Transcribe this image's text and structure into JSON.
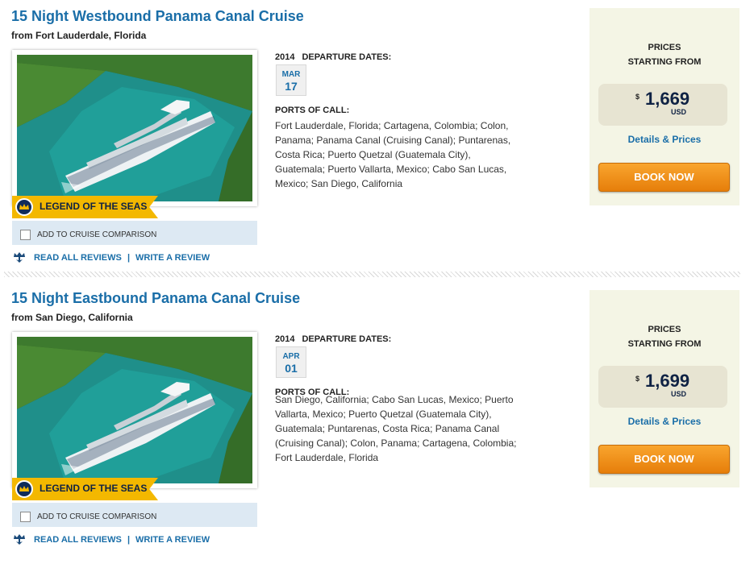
{
  "cruises": [
    {
      "title": "15 Night Westbound Panama Canal Cruise",
      "from": "from Fort Lauderdale, Florida",
      "ship_name": "LEGEND OF THE SEAS",
      "compare_label": "ADD TO CRUISE COMPARISON",
      "read_reviews": "READ ALL REVIEWS",
      "separator": "|",
      "write_review": "WRITE A REVIEW",
      "departure_year": "2014",
      "departure_label": "DEPARTURE DATES:",
      "departure_month": "MAR",
      "departure_day": "17",
      "ports_label": "PORTS OF CALL:",
      "ports_lines": [
        "Fort Lauderdale, Florida; Cartagena, Colombia; Colon,",
        "Panama; Panama Canal (Cruising Canal); Puntarenas,",
        "Costa Rica; Puerto Quetzal (Guatemala City),",
        "Guatemala; Puerto Vallarta, Mexico; Cabo San Lucas,",
        "Mexico; San Diego, California"
      ],
      "prices_label_1": "PRICES",
      "prices_label_2": "STARTING FROM",
      "currency_symbol": "$",
      "price": "1,669",
      "currency": "USD",
      "details_link": "Details & Prices",
      "book_button": "BOOK NOW"
    },
    {
      "title": "15 Night Eastbound Panama Canal Cruise",
      "from": "from San Diego, California",
      "ship_name": "LEGEND OF THE SEAS",
      "compare_label": "ADD TO CRUISE COMPARISON",
      "read_reviews": "READ ALL REVIEWS",
      "separator": "|",
      "write_review": "WRITE A REVIEW",
      "departure_year": "2014",
      "departure_label": "DEPARTURE DATES:",
      "departure_month": "APR",
      "departure_day": "01",
      "ports_label": "PORTS OF CALL:",
      "ports_lines": [
        "San Diego, California; Cabo San Lucas, Mexico; Puerto",
        "Vallarta, Mexico; Puerto Quetzal (Guatemala City),",
        "Guatemala; Puntarenas, Costa Rica; Panama Canal",
        "(Cruising Canal); Colon, Panama; Cartagena, Colombia;",
        "Fort Lauderdale, Florida"
      ],
      "prices_label_1": "PRICES",
      "prices_label_2": "STARTING FROM",
      "currency_symbol": "$",
      "price": "1,699",
      "currency": "USD",
      "details_link": "Details & Prices",
      "book_button": "BOOK NOW"
    }
  ],
  "colors": {
    "link_blue": "#1a6ea8",
    "navy": "#0f2244",
    "banner_yellow": "#f3b800",
    "book_orange": "#f39418",
    "price_panel_bg": "#f4f5e5",
    "compare_bg": "#dde9f3"
  },
  "icons": {
    "ship_logo": "crown-anchor-icon",
    "reviews": "crown-anchor-icon",
    "photo": "cruise-ship-photo"
  }
}
